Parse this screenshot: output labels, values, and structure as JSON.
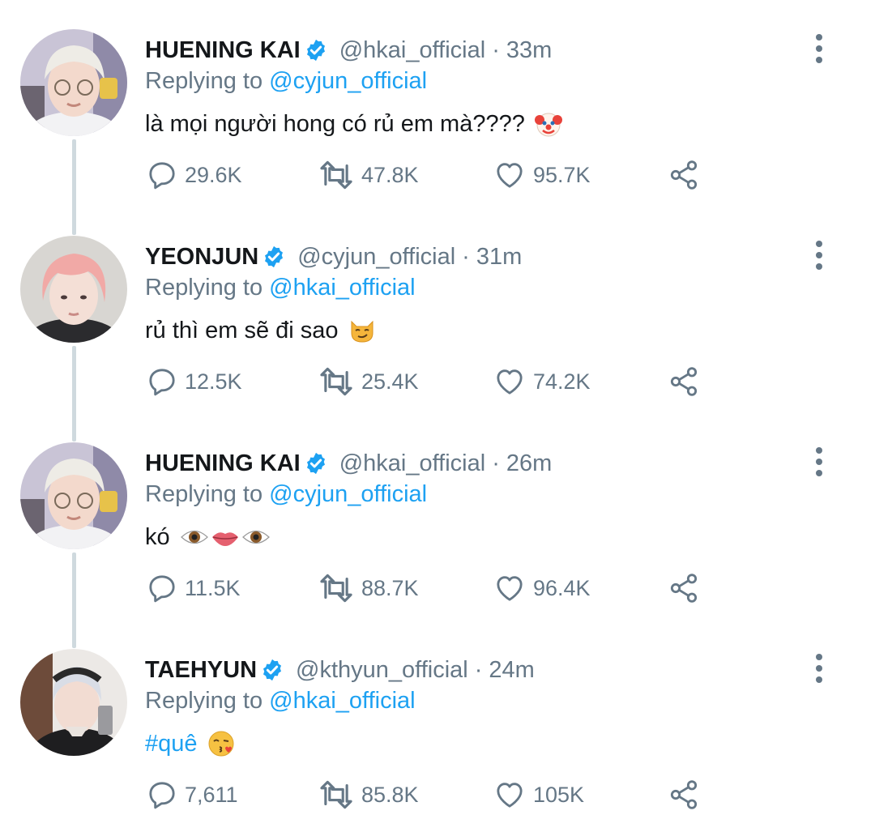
{
  "colors": {
    "accent": "#1da1f2",
    "muted": "#657786",
    "text": "#14171a",
    "thread_line": "#cfd9de"
  },
  "tweets": [
    {
      "name": "HUENING KAI",
      "handle": "@hkai_official",
      "time": "33m",
      "replying_prefix": "Replying to",
      "replying_to": "@cyjun_official",
      "text": "là mọi người hong có rủ em mà????",
      "emojis": [
        "clown-face"
      ],
      "counts": {
        "replies": "29.6K",
        "retweets": "47.8K",
        "likes": "95.7K"
      }
    },
    {
      "name": "YEONJUN",
      "handle": "@cyjun_official",
      "time": "31m",
      "replying_prefix": "Replying to",
      "replying_to": "@hkai_official",
      "text": "rủ thì em sẽ đi sao",
      "emojis": [
        "smirking-cat"
      ],
      "counts": {
        "replies": "12.5K",
        "retweets": "25.4K",
        "likes": "74.2K"
      }
    },
    {
      "name": "HUENING KAI",
      "handle": "@hkai_official",
      "time": "26m",
      "replying_prefix": "Replying to",
      "replying_to": "@cyjun_official",
      "text": "kó",
      "emojis": [
        "eye",
        "lips",
        "eye"
      ],
      "counts": {
        "replies": "11.5K",
        "retweets": "88.7K",
        "likes": "96.4K"
      }
    },
    {
      "name": "TAEHYUN",
      "handle": "@kthyun_official",
      "time": "24m",
      "replying_prefix": "Replying to",
      "replying_to": "@hkai_official",
      "text": "#quê",
      "emojis": [
        "kiss-face"
      ],
      "counts": {
        "replies": "7,611",
        "retweets": "85.8K",
        "likes": "105K"
      }
    }
  ]
}
